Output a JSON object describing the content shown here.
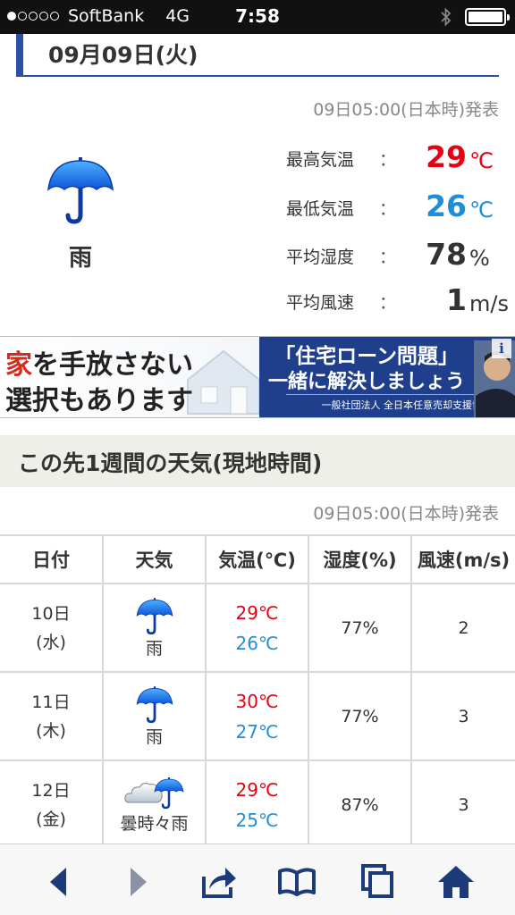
{
  "status_bar": {
    "carrier": "SoftBank",
    "network": "4G",
    "time": "7:58"
  },
  "day_header": {
    "date": "09月09日(火)"
  },
  "today": {
    "issued": "09日05:00(日本時)発表",
    "weather_icon": "umbrella-icon",
    "weather_label": "雨",
    "stats": [
      {
        "label": "最高気温",
        "colon": "：",
        "value": "29",
        "unit": "℃",
        "color": "#e60012"
      },
      {
        "label": "最低気温",
        "colon": "：",
        "value": "26",
        "unit": "℃",
        "color": "#1e8ed8"
      },
      {
        "label": "平均湿度",
        "colon": "：",
        "value": "78",
        "unit": "%",
        "color": "#333333"
      },
      {
        "label": "平均風速",
        "colon": "：",
        "value": "1",
        "unit": "m/s",
        "color": "#333333"
      }
    ]
  },
  "ad": {
    "left_line1_accent": "家",
    "left_line1_rest": "を手放さない",
    "left_line2": "選択もあります",
    "right_line1": "「住宅ローン問題」",
    "right_line2": "一緒に解決しましょう",
    "right_line3": "一般社団法人 全日本任意売却支援協会",
    "info_label": "i"
  },
  "week": {
    "title": "この先1週間の天気(現地時間)",
    "issued": "09日05:00(日本時)発表",
    "columns": [
      "日付",
      "天気",
      "気温(℃)",
      "湿度(%)",
      "風速(m/s)"
    ],
    "rows": [
      {
        "day": "10日",
        "dow": "(水)",
        "icon": "umbrella-icon",
        "weather": "雨",
        "high": "29℃",
        "low": "26℃",
        "humidity": "77%",
        "wind": "2"
      },
      {
        "day": "11日",
        "dow": "(木)",
        "icon": "umbrella-icon",
        "weather": "雨",
        "high": "30℃",
        "low": "27℃",
        "humidity": "77%",
        "wind": "3"
      },
      {
        "day": "12日",
        "dow": "(金)",
        "icon": "cloud-umbrella-icon",
        "weather": "曇時々雨",
        "high": "29℃",
        "low": "25℃",
        "humidity": "87%",
        "wind": "3"
      }
    ]
  },
  "toolbar": {
    "items": [
      "back-icon",
      "forward-icon",
      "share-icon",
      "bookmarks-icon",
      "tabs-icon",
      "home-icon"
    ]
  },
  "colors": {
    "accent": "#2a4fa4",
    "high": "#e60012",
    "low": "#1e8ed8",
    "toolbar_icon": "#1d3b78"
  }
}
